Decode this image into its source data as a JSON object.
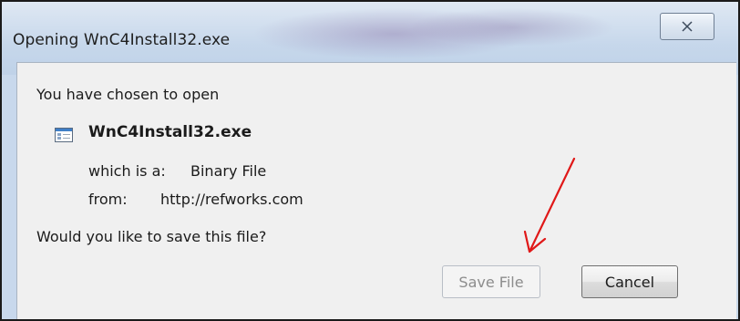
{
  "window": {
    "title": "Opening WnC4Install32.exe",
    "close_icon": "close-x-icon"
  },
  "dialog": {
    "prompt_open": "You have chosen to open",
    "file_icon": "application-file-icon",
    "file_name": "WnC4Install32.exe",
    "which_is_label": "which is a:",
    "which_is_value": "Binary File",
    "from_label": "from:",
    "from_value": "http://refworks.com",
    "prompt_save": "Would you like to save this file?"
  },
  "buttons": {
    "save_label": "Save File",
    "save_state": "disabled",
    "cancel_label": "Cancel"
  },
  "annotation": {
    "type": "red-arrow",
    "color": "#e01818"
  }
}
